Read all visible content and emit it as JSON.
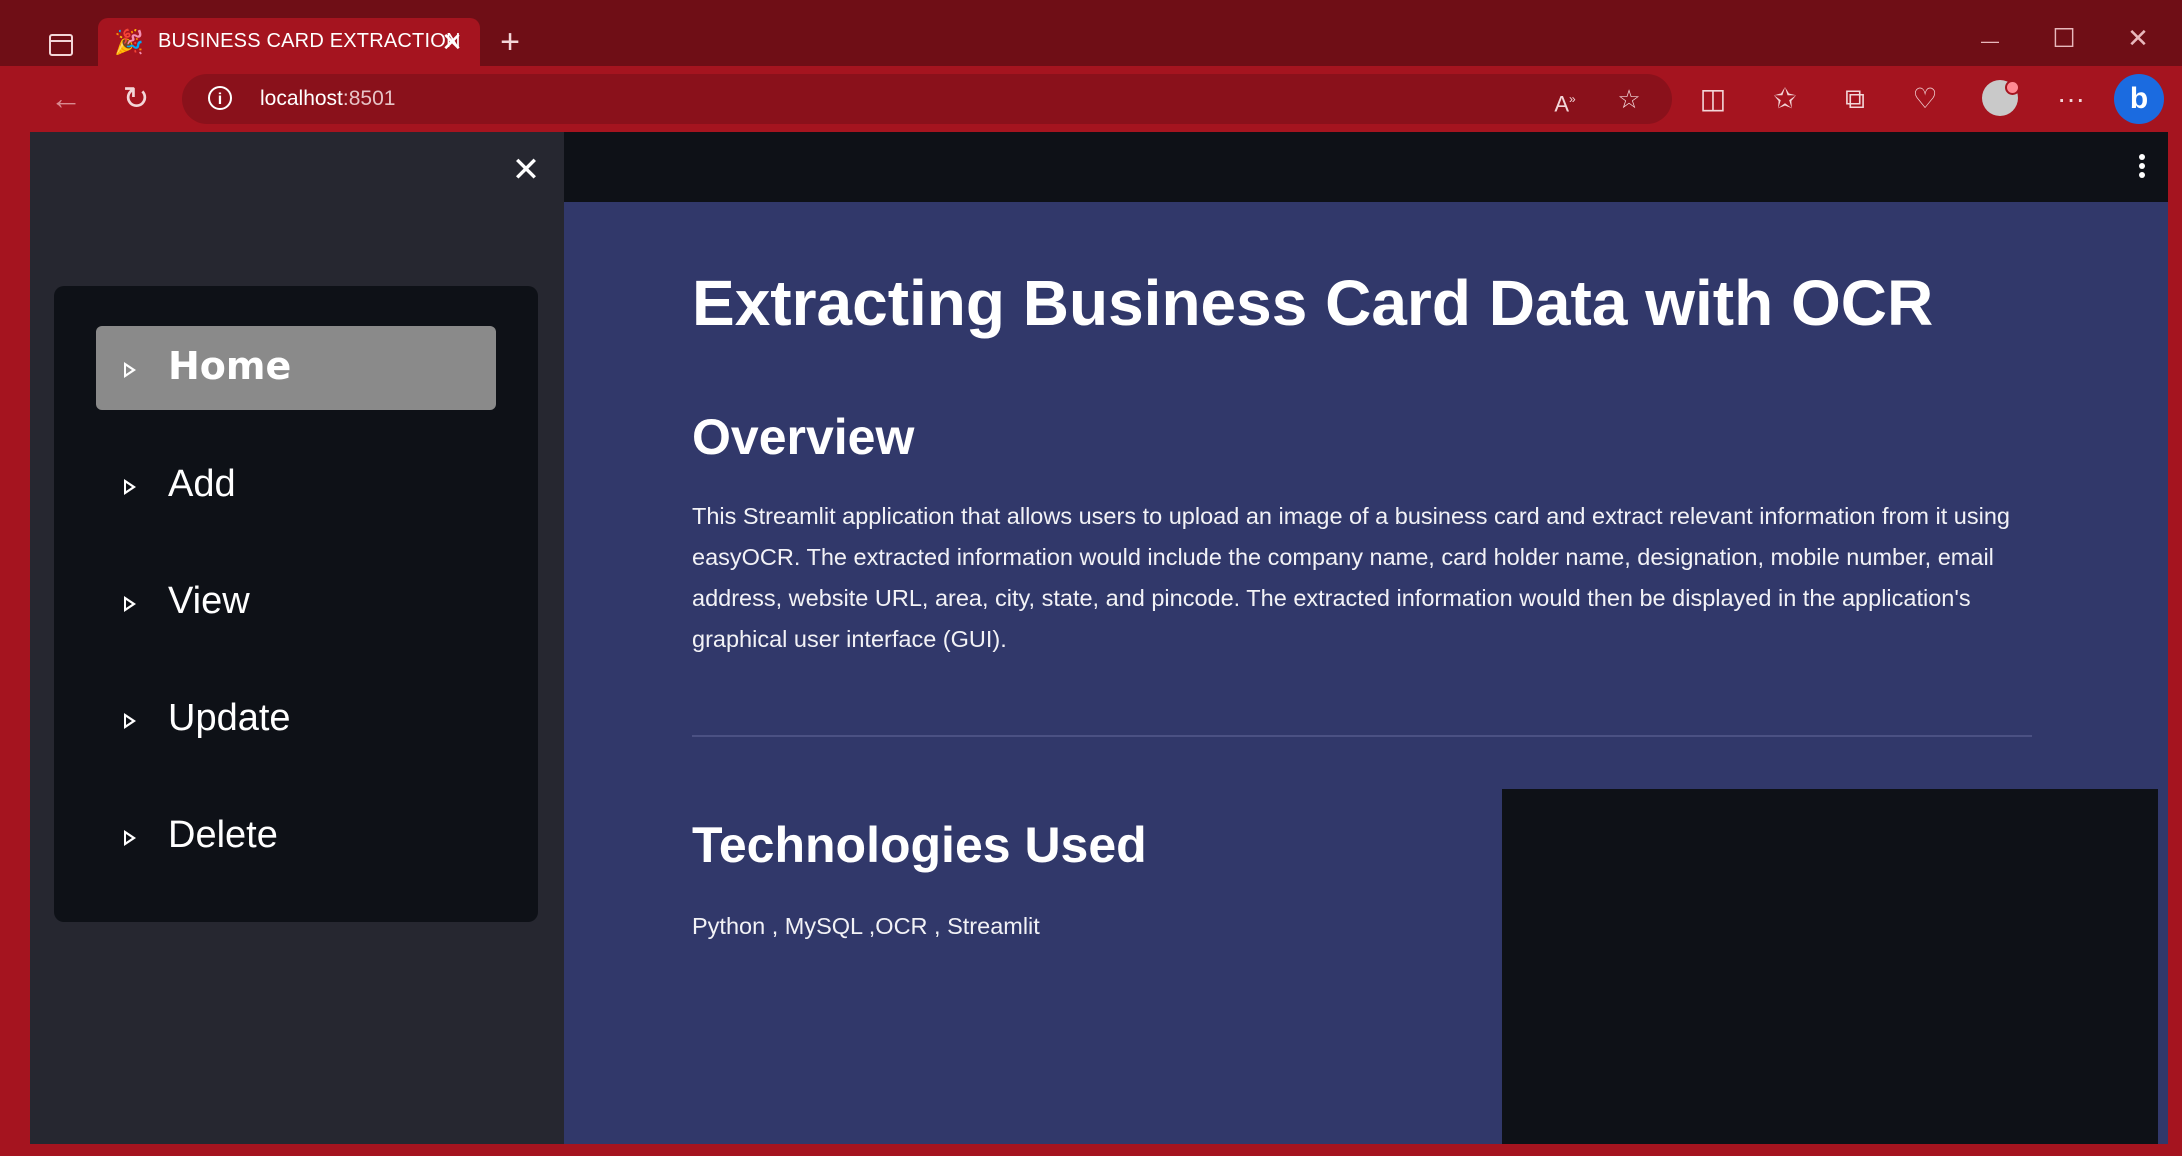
{
  "browser": {
    "tab_title": "BUSINESS CARD EXTRACTION",
    "tab_close": "✕",
    "new_tab": "+",
    "url_host": "localhost",
    "url_port": ":8501",
    "controls": {
      "minimize": "—",
      "maximize": "☐",
      "close": "✕"
    },
    "bing_label": "b",
    "more_label": "···"
  },
  "sidebar": {
    "close": "✕",
    "items": [
      {
        "label": "Home",
        "active": true
      },
      {
        "label": "Add",
        "active": false
      },
      {
        "label": "View",
        "active": false
      },
      {
        "label": "Update",
        "active": false
      },
      {
        "label": "Delete",
        "active": false
      }
    ]
  },
  "main": {
    "title": "Extracting Business Card Data with OCR",
    "overview_heading": "Overview",
    "overview_text": "This Streamlit application that allows users to upload an image of a business card and extract relevant information from it using easyOCR. The extracted information would include the company name, card holder name, designation, mobile number, email address, website URL, area, city, state, and pincode. The extracted information would then be displayed in the application's graphical user interface (GUI).",
    "tech_heading": "Technologies Used",
    "tech_text": "Python , MySQL ,OCR , Streamlit"
  },
  "colors": {
    "browser_frame": "#a5141f",
    "titlebar": "#6f0e16",
    "sidebar_bg": "#262730",
    "menu_bg": "#0e1117",
    "active_item": "#8a8a8a",
    "main_bg": "#31386a",
    "header_bg": "#0e1117"
  }
}
